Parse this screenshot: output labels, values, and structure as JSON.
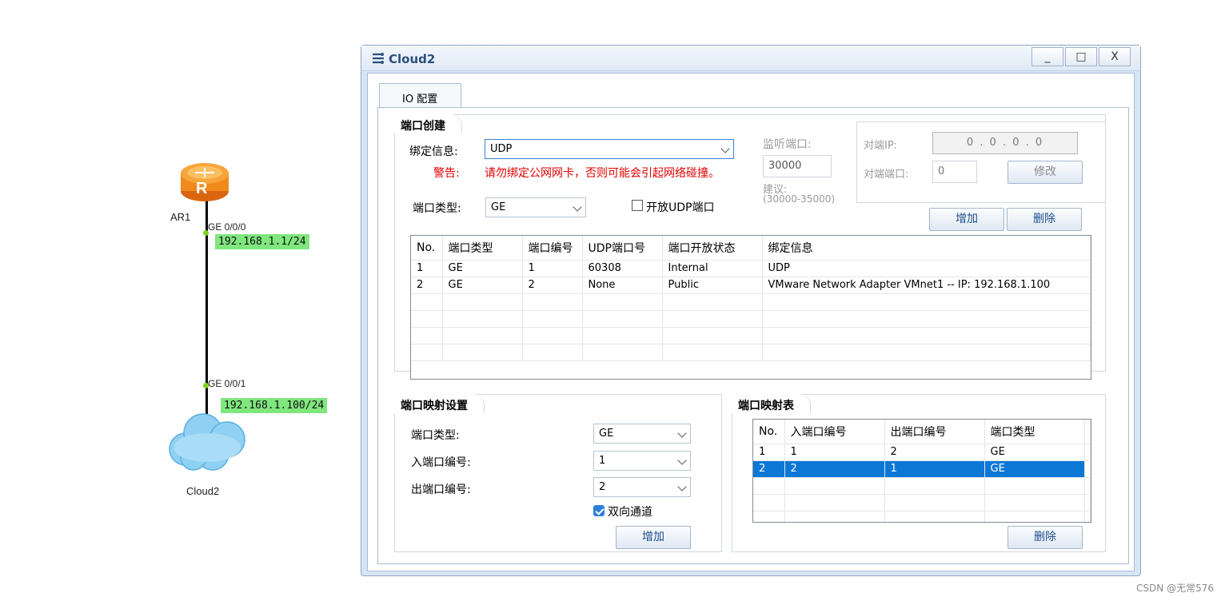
{
  "topology": {
    "router": {
      "name": "AR1",
      "letter": "R",
      "port": "GE 0/0/0",
      "ip": "192.168.1.1/24"
    },
    "cloud": {
      "name": "Cloud2",
      "port": "GE 0/0/1",
      "ip": "192.168.1.100/24"
    }
  },
  "window": {
    "title": "Cloud2",
    "controls": {
      "minimize": "_",
      "maximize": "□",
      "close": "X"
    },
    "tab": "IO 配置"
  },
  "port_create": {
    "title": "端口创建",
    "bind_label": "绑定信息:",
    "bind_value": "UDP",
    "warning_label": "警告:",
    "warning_text": "请勿绑定公网网卡，否则可能会引起网络碰撞。",
    "port_type_label": "端口类型:",
    "port_type_value": "GE",
    "open_udp_label": "开放UDP端口",
    "open_udp_checked": false,
    "listen_label": "监听端口:",
    "listen_value": "30000",
    "suggest_label": "建议:",
    "suggest_range": "(30000-35000)",
    "peer_ip_label": "对端IP:",
    "peer_ip_value": "0 . 0 . 0 . 0",
    "peer_port_label": "对端端口:",
    "peer_port_value": "0",
    "modify_button": "修改",
    "add_button": "增加",
    "delete_button": "删除",
    "table": {
      "headers": [
        "No.",
        "端口类型",
        "端口编号",
        "UDP端口号",
        "端口开放状态",
        "绑定信息"
      ],
      "rows": [
        [
          "1",
          "GE",
          "1",
          "60308",
          "Internal",
          "UDP"
        ],
        [
          "2",
          "GE",
          "2",
          "None",
          "Public",
          "VMware Network Adapter VMnet1 -- IP: 192.168.1.100"
        ]
      ]
    }
  },
  "port_map_settings": {
    "title": "端口映射设置",
    "port_type_label": "端口类型:",
    "port_type_value": "GE",
    "in_port_label": "入端口编号:",
    "in_port_value": "1",
    "out_port_label": "出端口编号:",
    "out_port_value": "2",
    "bidirectional_label": "双向通道",
    "bidirectional_checked": true,
    "add_button": "增加"
  },
  "port_map_table": {
    "title": "端口映射表",
    "headers": [
      "No.",
      "入端口编号",
      "出端口编号",
      "端口类型"
    ],
    "rows": [
      [
        "1",
        "1",
        "2",
        "GE"
      ],
      [
        "2",
        "2",
        "1",
        "GE"
      ]
    ],
    "selected_row": 2,
    "delete_button": "删除"
  },
  "watermark": "CSDN @无常576"
}
